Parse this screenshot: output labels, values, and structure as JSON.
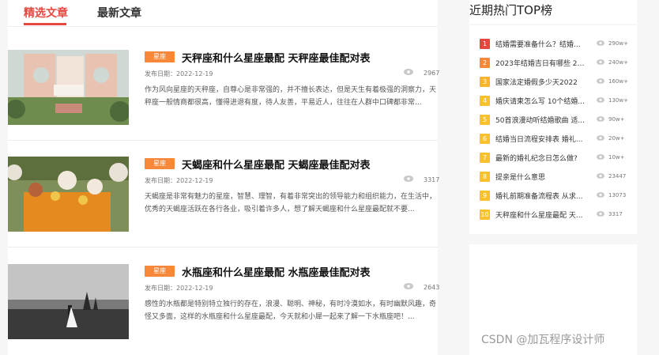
{
  "tabs": [
    {
      "label": "精选文章",
      "active": true
    },
    {
      "label": "最新文章",
      "active": false
    }
  ],
  "articles": [
    {
      "category": "星座",
      "title": "天秤座和什么星座最配 天秤座最佳配对表",
      "date": "发布日期：2022-12-19",
      "views": "2967",
      "summary": "作为风向星座的天秤座，自尊心是非常强的，并不擅长表达，但是天生有着极强的洞察力，天秤座一般情商都很高，懂得进退有度，待人友善，平易近人，往往在人群中口碑都非常..."
    },
    {
      "category": "星座",
      "title": "天蝎座和什么星座最配 天蝎座最佳配对表",
      "date": "发布日期：2022-12-19",
      "views": "3317",
      "summary": "天蝎座是非常有魅力的星座，智慧、理智，有着非常突出的领导能力和组织能力，在生活中，优秀的天蝎座活跃在各行各业，吸引着许多人，想了解天蝎座和什么星座最配就不要..."
    },
    {
      "category": "星座",
      "title": "水瓶座和什么星座最配 水瓶座最佳配对表",
      "date": "发布日期：2022-12-19",
      "views": "2643",
      "summary": "感性的水瓶都是特别特立独行的存在，浪漫、聪明、神秘，有时冷漠如水，有时幽默风趣，奇怪又多面，这样的水瓶座和什么星座最配，今天就和小犀一起来了解一下水瓶座吧！..."
    }
  ],
  "sidebar": {
    "title": "近期热门TOP榜",
    "items": [
      {
        "rank": "1",
        "text": "结婚需要准备什么？结婚...",
        "views": "290w+"
      },
      {
        "rank": "2",
        "text": "2023年结婚吉日有哪些 20...",
        "views": "240w+"
      },
      {
        "rank": "3",
        "text": "国家法定婚假多少天2022",
        "views": "160w+"
      },
      {
        "rank": "4",
        "text": "婚庆请柬怎么写 10个结婚...",
        "views": "130w+"
      },
      {
        "rank": "5",
        "text": "50首浪漫动听结婚歌曲 适...",
        "views": "90w+"
      },
      {
        "rank": "6",
        "text": "结婚当日流程安排表 婚礼...",
        "views": "20w+"
      },
      {
        "rank": "7",
        "text": "最新的婚礼纪念日怎么做?",
        "views": "10w+"
      },
      {
        "rank": "8",
        "text": "提亲是什么意思",
        "views": "23447"
      },
      {
        "rank": "9",
        "text": "婚礼前期准备流程表 从求...",
        "views": "13073"
      },
      {
        "rank": "10",
        "text": "天秤座和什么星座最配 天...",
        "views": "3317"
      }
    ],
    "rank_colors": [
      "#e8473f",
      "#f7883a",
      "#f7b52c",
      "#f7c22c",
      "#f7c22c",
      "#f7c22c",
      "#f7c22c",
      "#f7c22c",
      "#f7c22c",
      "#f7c22c"
    ]
  },
  "watermark": "CSDN @加瓦程序设计师",
  "icons": {
    "views": "eye-icon"
  },
  "colors": {
    "accent": "#e8473f",
    "badge": "#f7883a"
  }
}
